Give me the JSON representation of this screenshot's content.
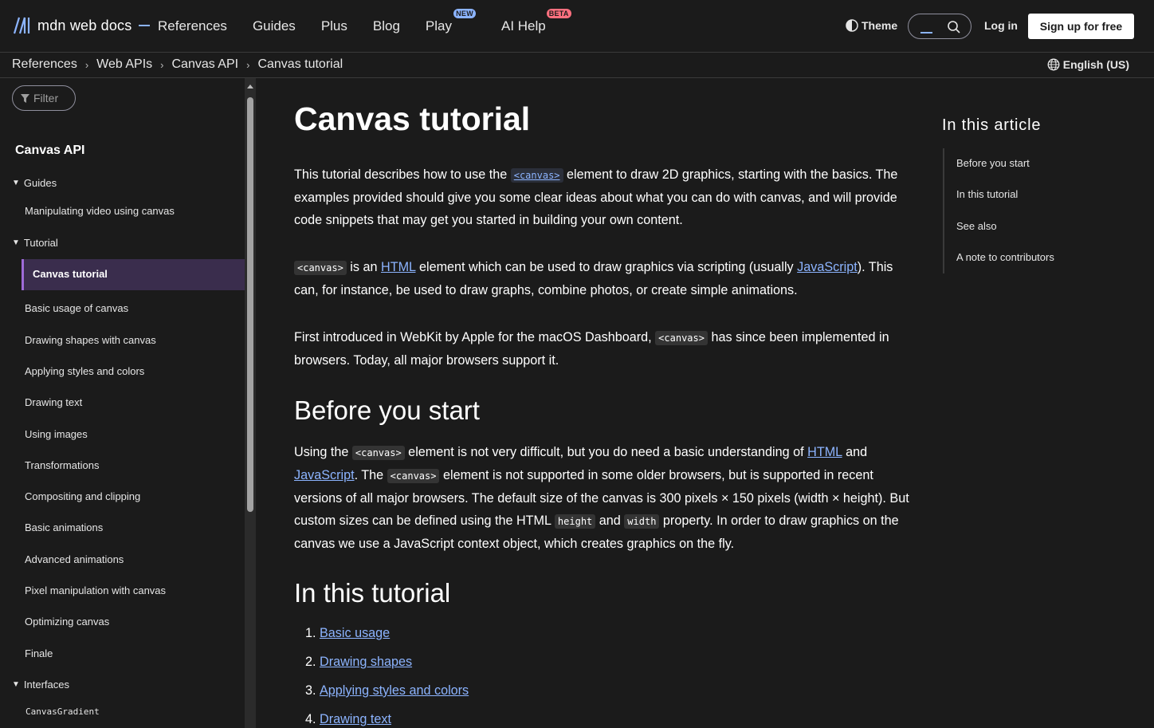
{
  "header": {
    "logo_text": "mdn web docs",
    "nav": [
      {
        "label": "References"
      },
      {
        "label": "Guides"
      },
      {
        "label": "Plus"
      },
      {
        "label": "Blog"
      },
      {
        "label": "Play",
        "badge": "NEW"
      },
      {
        "label": "AI Help",
        "badge": "BETA"
      }
    ],
    "theme_label": "Theme",
    "login_label": "Log in",
    "signup_label": "Sign up for free"
  },
  "breadcrumb": [
    "References",
    "Web APIs",
    "Canvas API",
    "Canvas tutorial"
  ],
  "language": "English (US)",
  "sidebar": {
    "filter_placeholder": "Filter",
    "title": "Canvas API",
    "groups": {
      "guides": "Guides",
      "tutorial": "Tutorial",
      "interfaces": "Interfaces"
    },
    "guides_items": [
      "Manipulating video using canvas"
    ],
    "tutorial_active": "Canvas tutorial",
    "tutorial_items": [
      "Basic usage of canvas",
      "Drawing shapes with canvas",
      "Applying styles and colors",
      "Drawing text",
      "Using images",
      "Transformations",
      "Compositing and clipping",
      "Basic animations",
      "Advanced animations",
      "Pixel manipulation with canvas",
      "Optimizing canvas",
      "Finale"
    ],
    "interfaces_items": [
      "CanvasGradient"
    ]
  },
  "main": {
    "title": "Canvas tutorial",
    "intro": {
      "a": "This tutorial describes how to use the ",
      "code": "<canvas>",
      "b": " element to draw 2D graphics, starting with the basics. The examples provided should give you some clear ideas about what you can do with canvas, and will provide code snippets that may get you started in building your own content."
    },
    "p2": {
      "code": "<canvas>",
      "a": " is an ",
      "link1": "HTML",
      "b": " element which can be used to draw graphics via scripting (usually ",
      "link2": "JavaScript",
      "c": "). This can, for instance, be used to draw graphs, combine photos, or create simple animations."
    },
    "p3": {
      "a": "First introduced in WebKit by Apple for the macOS Dashboard, ",
      "code": "<canvas>",
      "b": " has since been implemented in browsers. Today, all major browsers support it."
    },
    "h2_before": "Before you start",
    "p4": {
      "a": "Using the ",
      "code1": "<canvas>",
      "b": " element is not very difficult, but you do need a basic understanding of ",
      "link1": "HTML",
      "c": " and ",
      "link2": "JavaScript",
      "d": ". The ",
      "code2": "<canvas>",
      "e": " element is not supported in some older browsers, but is supported in recent versions of all major browsers. The default size of the canvas is 300 pixels × 150 pixels (width × height). But custom sizes can be defined using the HTML ",
      "code3": "height",
      "f": " and ",
      "code4": "width",
      "g": " property. In order to draw graphics on the canvas we use a JavaScript context object, which creates graphics on the fly."
    },
    "h2_tutorial": "In this tutorial",
    "tutorial_list": [
      {
        "num": "1.",
        "label": "Basic usage"
      },
      {
        "num": "2.",
        "label": "Drawing shapes"
      },
      {
        "num": "3.",
        "label": "Applying styles and colors"
      },
      {
        "num": "4.",
        "label": "Drawing text"
      }
    ]
  },
  "article_nav": {
    "title": "In this article",
    "items": [
      "Before you start",
      "In this tutorial",
      "See also",
      "A note to contributors"
    ]
  }
}
